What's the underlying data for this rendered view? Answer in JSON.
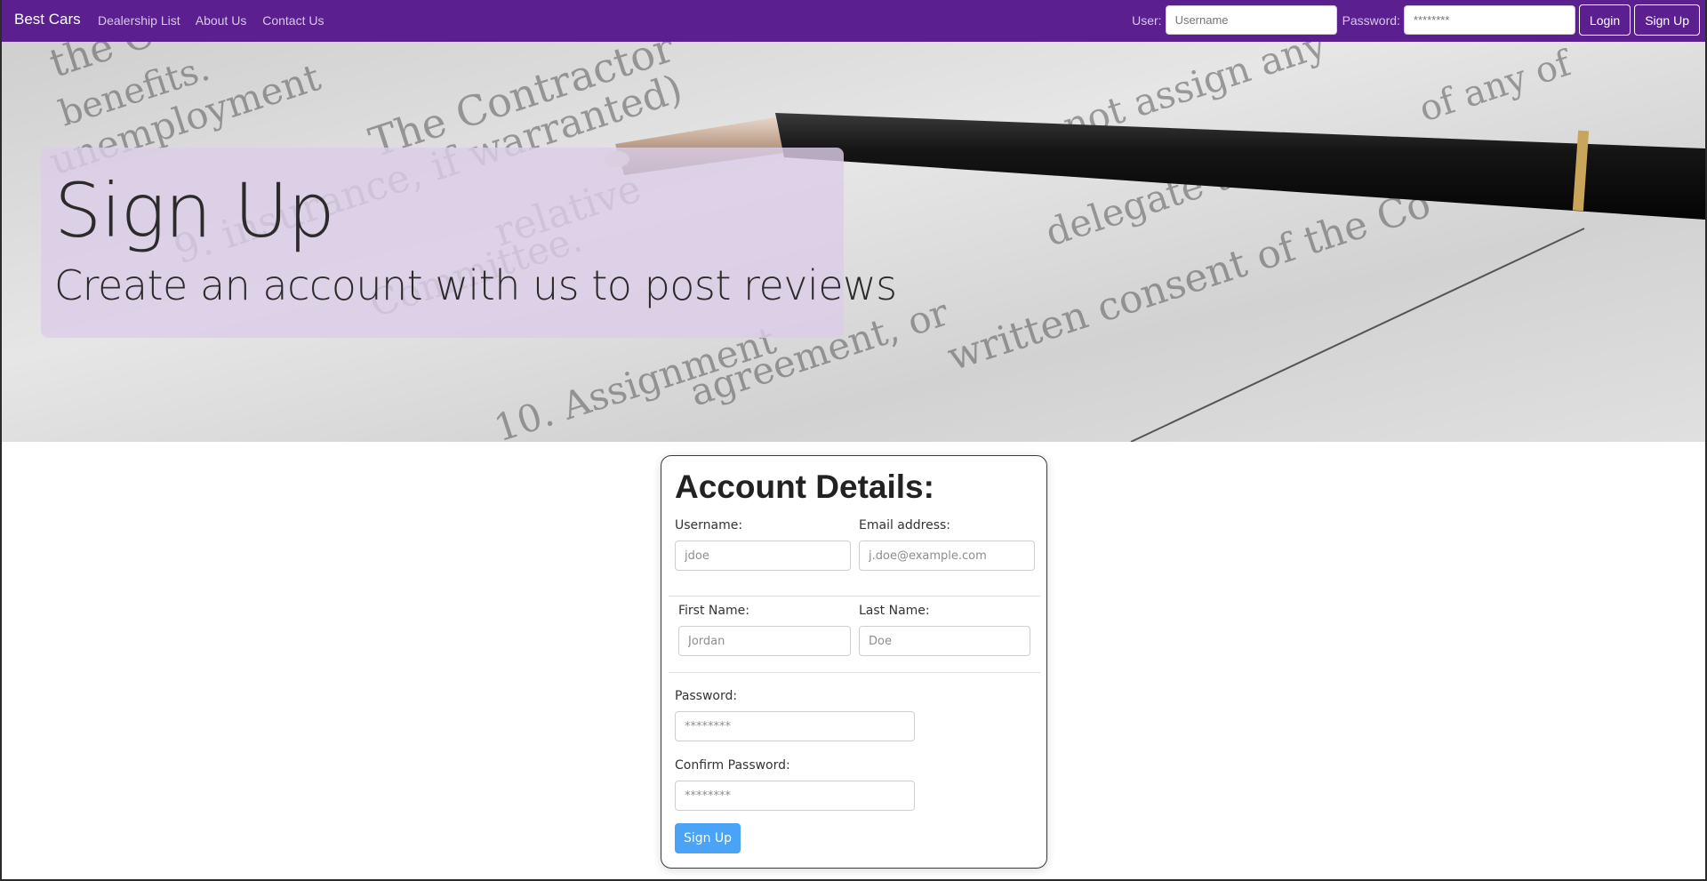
{
  "navbar": {
    "brand": "Best Cars",
    "links": [
      "Dealership List",
      "About Us",
      "Contact Us"
    ],
    "user_label": "User:",
    "user_placeholder": "Username",
    "password_label": "Password:",
    "password_placeholder": "********",
    "login_label": "Login",
    "signup_label": "Sign Up"
  },
  "hero": {
    "title": "Sign Up",
    "subtitle": "Create an account with us to post reviews"
  },
  "form": {
    "heading": "Account Details:",
    "username_label": "Username:",
    "username_placeholder": "jdoe",
    "email_label": "Email address:",
    "email_placeholder": "j.doe@example.com",
    "first_name_label": "First Name:",
    "first_name_placeholder": "Jordan",
    "last_name_label": "Last Name:",
    "last_name_placeholder": "Doe",
    "password_label": "Password:",
    "password_placeholder": "********",
    "confirm_password_label": "Confirm Password:",
    "confirm_password_placeholder": "********",
    "submit_label": "Sign Up"
  },
  "colors": {
    "navbar_bg": "#5b1f8f",
    "hero_card_bg": "#dacde6",
    "submit_bg": "#4aa3f5"
  }
}
